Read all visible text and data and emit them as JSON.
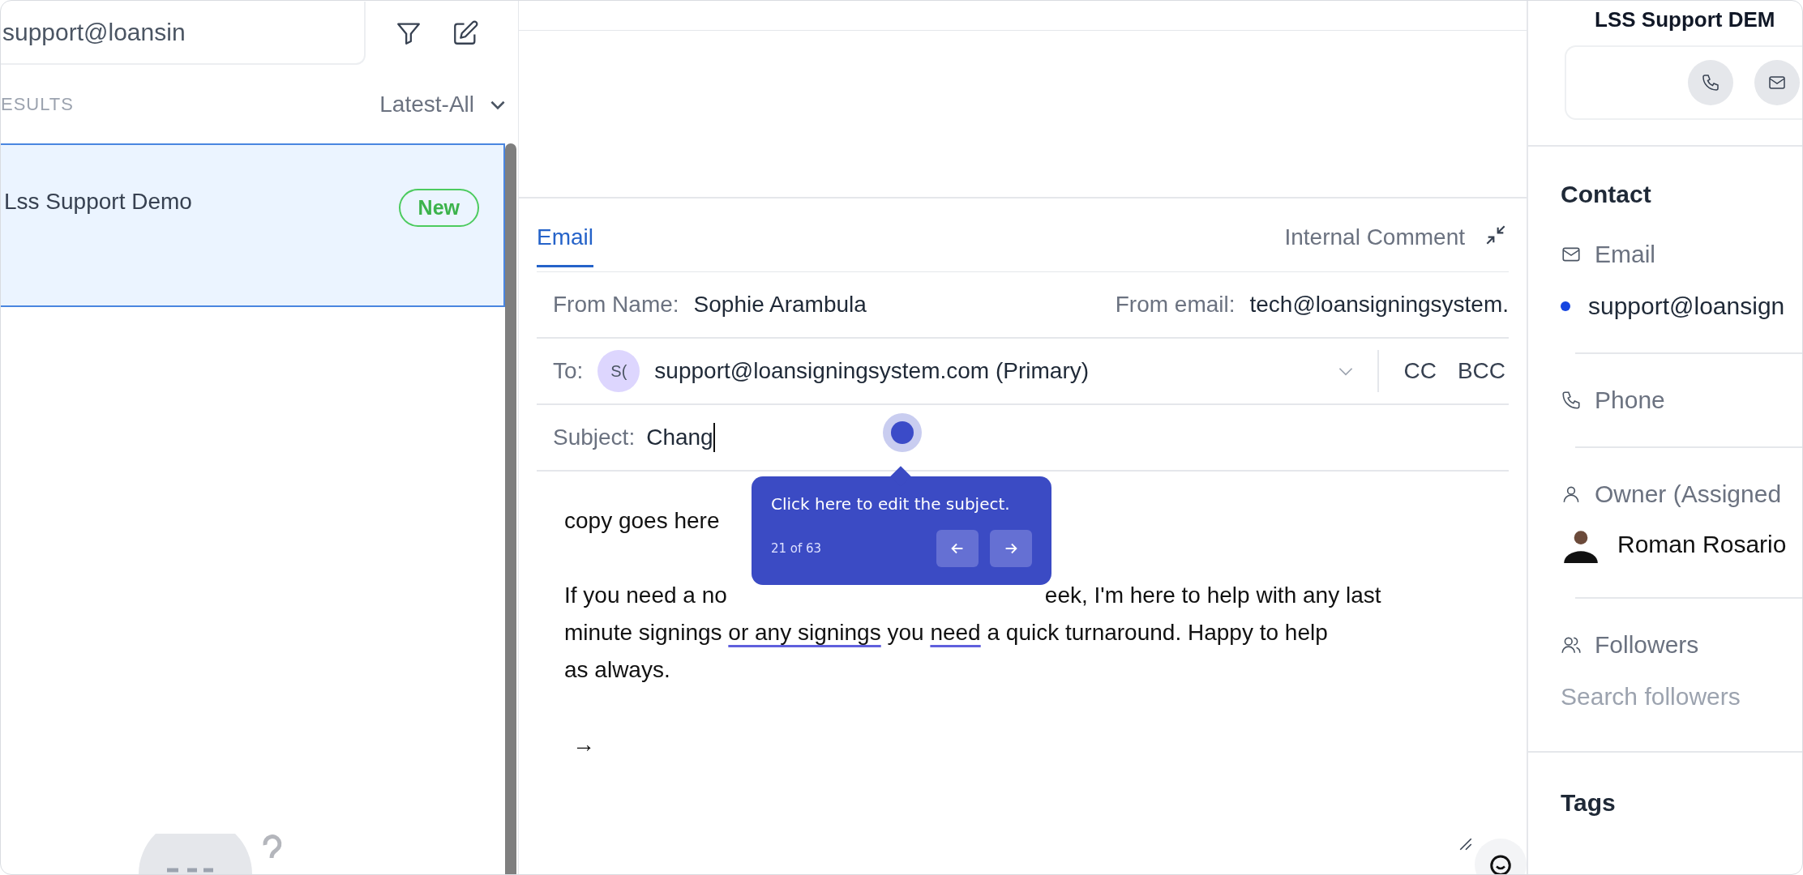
{
  "search": {
    "value": "support@loansin"
  },
  "results": {
    "label": "ESULTS",
    "sort": "Latest-All"
  },
  "conversations": [
    {
      "name": "Lss Support Demo",
      "badge": "New",
      "selected": true
    }
  ],
  "composer": {
    "tabs": [
      {
        "label": "Email",
        "selected": true
      },
      {
        "label": "Internal Comment",
        "selected": false
      }
    ],
    "from_name_label": "From Name:",
    "from_name": "Sophie Arambula",
    "from_email_label": "From email:",
    "from_email": "tech@loansigningsystem.",
    "to_label": "To:",
    "to_avatar": "S(",
    "to": "support@loansigningsystem.com (Primary)",
    "cc": "CC",
    "bcc": "BCC",
    "subject_label": "Subject:",
    "subject": "Chang",
    "greeting": "copy goes here",
    "paragraph": [
      [
        {
          "kind": "text",
          "text": "If you need a no"
        },
        {
          "kind": "covered"
        },
        {
          "kind": "text",
          "text": "eek, I'm here to help with any last"
        }
      ],
      [
        {
          "kind": "text",
          "text": "minute signings "
        },
        {
          "kind": "flagged",
          "text": "or any signings"
        },
        {
          "kind": "text",
          "text": " you "
        },
        {
          "kind": "flagged",
          "text": "need"
        },
        {
          "kind": "text",
          "text": " a quick turnaround. Happy to help"
        }
      ],
      [
        {
          "kind": "text",
          "text": "as always."
        }
      ]
    ],
    "arrow": "→"
  },
  "tooltip": {
    "text": "Click here to edit the subject.",
    "step": "21 of 63"
  },
  "contact_panel": {
    "title": "LSS Support DEM",
    "section": "Contact",
    "email_label": "Email",
    "email": "support@loansign",
    "phone_label": "Phone",
    "owner_label": "Owner (Assigned",
    "owner": "Roman Rosario",
    "followers_label": "Followers",
    "followers_placeholder": "Search followers",
    "tags_label": "Tags"
  }
}
